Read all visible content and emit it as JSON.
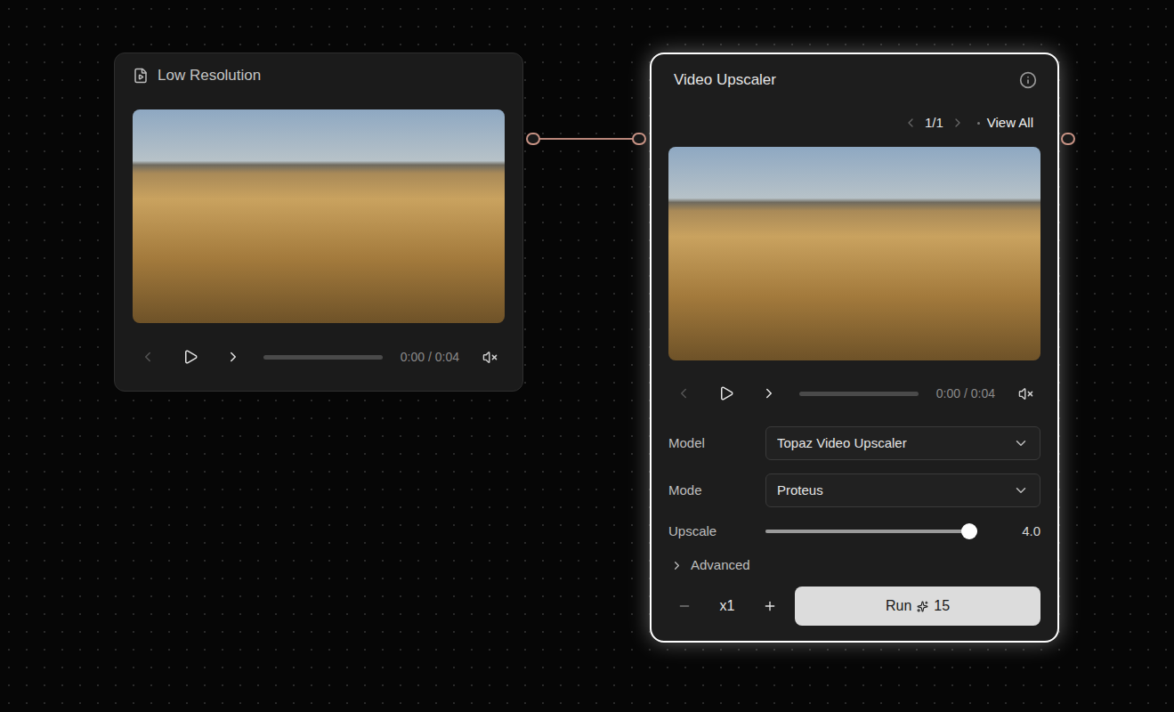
{
  "nodes": {
    "low_resolution": {
      "title": "Low Resolution",
      "player": {
        "time": "0:00 / 0:04",
        "progress": 0,
        "muted": true,
        "prev_disabled": true,
        "next_disabled": false
      }
    },
    "upscaler": {
      "title": "Video Upscaler",
      "selected": true,
      "pager": {
        "position": "1/1",
        "prev_disabled": true,
        "next_disabled": true,
        "view_all": "View All"
      },
      "player": {
        "time": "0:00 / 0:04",
        "progress": 0,
        "muted": true,
        "prev_disabled": true,
        "next_disabled": false
      },
      "fields": [
        {
          "kind": "select",
          "label": "Model",
          "value": "Topaz Video Upscaler"
        },
        {
          "kind": "select",
          "label": "Mode",
          "value": "Proteus"
        },
        {
          "kind": "slider",
          "label": "Upscale",
          "level": 1,
          "reading": "4.0"
        }
      ],
      "advanced": {
        "label": "Advanced",
        "expanded": false
      },
      "run": {
        "count": "x1",
        "label": "Run",
        "cost": "15"
      }
    }
  }
}
